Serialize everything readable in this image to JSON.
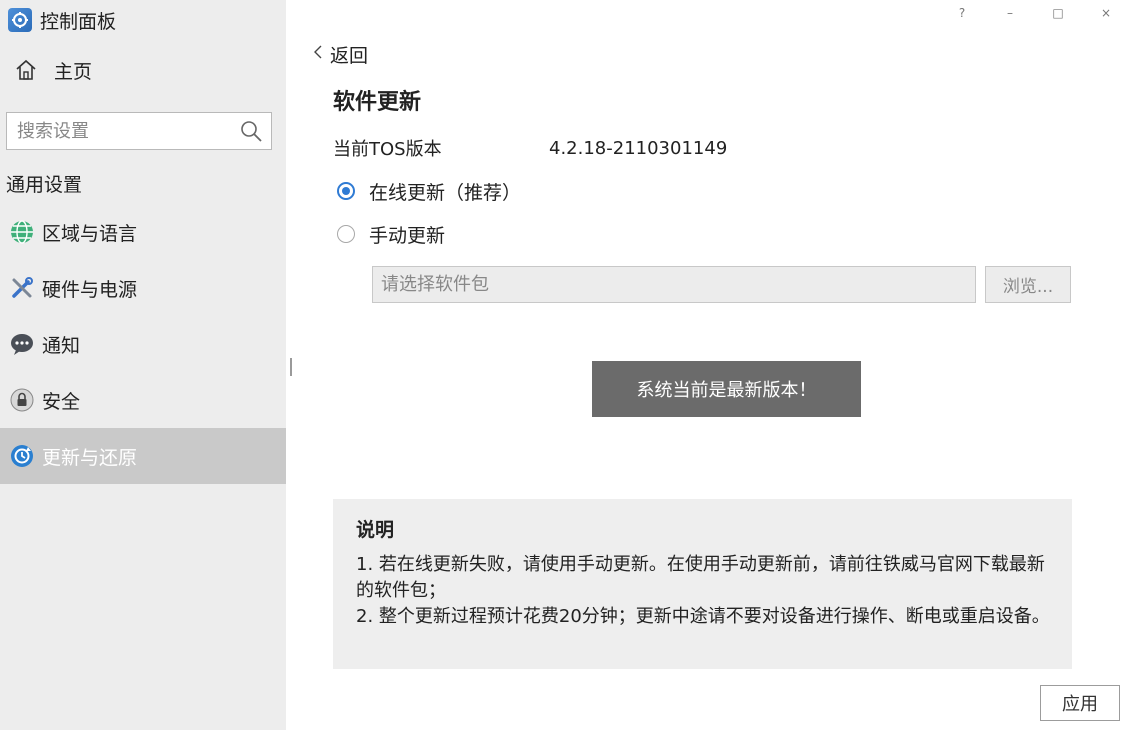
{
  "app": {
    "title": "控制面板"
  },
  "window_controls": {
    "help": "?",
    "minimize": "–",
    "maximize": "□",
    "close": "×"
  },
  "sidebar": {
    "home_label": "主页",
    "search_placeholder": "搜索设置",
    "section_title": "通用设置",
    "items": [
      {
        "label": "区域与语言",
        "icon": "globe-icon"
      },
      {
        "label": "硬件与电源",
        "icon": "tools-icon"
      },
      {
        "label": "通知",
        "icon": "chat-bubble-icon"
      },
      {
        "label": "安全",
        "icon": "lock-icon"
      },
      {
        "label": "更新与还原",
        "icon": "update-icon",
        "active": true
      }
    ]
  },
  "main": {
    "back_label": "返回",
    "title": "软件更新",
    "version_label": "当前TOS版本",
    "version_value": "4.2.18-2110301149",
    "options": [
      {
        "label": "在线更新（推荐）",
        "checked": true
      },
      {
        "label": "手动更新",
        "checked": false
      }
    ],
    "package_placeholder": "请选择软件包",
    "browse_label": "浏览...",
    "status_label": "系统当前是最新版本！",
    "note": {
      "title": "说明",
      "lines": [
        "1. 若在线更新失败，请使用手动更新。在使用手动更新前，请前往铁威马官网下载最新的软件包；",
        "2. 整个更新过程预计花费20分钟；更新中途请不要对设备进行操作、断电或重启设备。"
      ]
    },
    "apply_label": "应用"
  },
  "colors": {
    "accent": "#2f7bd4",
    "active_nav": "#c9c9c9",
    "status_button": "#6b6b6b"
  }
}
